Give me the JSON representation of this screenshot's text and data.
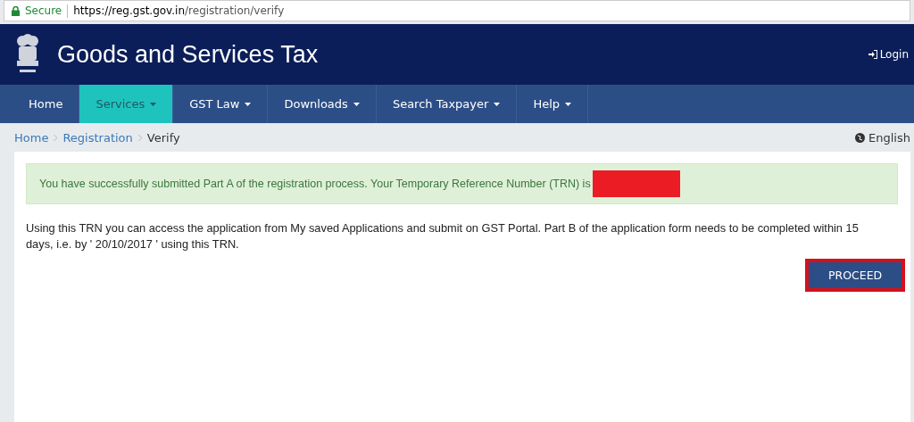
{
  "address_bar": {
    "security": "Secure",
    "url_host": "https://reg.gst.gov.in",
    "url_path": "/registration/verify"
  },
  "header": {
    "title": "Goods and Services Tax",
    "login": "Login"
  },
  "nav": [
    {
      "label": "Home",
      "selected": false,
      "dropdown": false
    },
    {
      "label": "Services",
      "selected": true,
      "dropdown": true
    },
    {
      "label": "GST Law",
      "selected": false,
      "dropdown": true
    },
    {
      "label": "Downloads",
      "selected": false,
      "dropdown": true
    },
    {
      "label": "Search Taxpayer",
      "selected": false,
      "dropdown": true
    },
    {
      "label": "Help",
      "selected": false,
      "dropdown": true
    }
  ],
  "breadcrumb": [
    {
      "label": "Home",
      "link": true
    },
    {
      "label": "Registration",
      "link": true
    },
    {
      "label": "Verify",
      "link": false
    }
  ],
  "language": "English",
  "alert": {
    "text": "You have successfully submitted Part A of the registration process. Your Temporary Reference Number (TRN) is"
  },
  "info": "Using this TRN you can access the application from My saved Applications and submit on GST Portal. Part B of the application form needs to be completed within 15 days, i.e. by ' 20/10/2017 ' using this TRN.",
  "proceed_button": {
    "label": "PROCEED",
    "highlighted": true
  }
}
